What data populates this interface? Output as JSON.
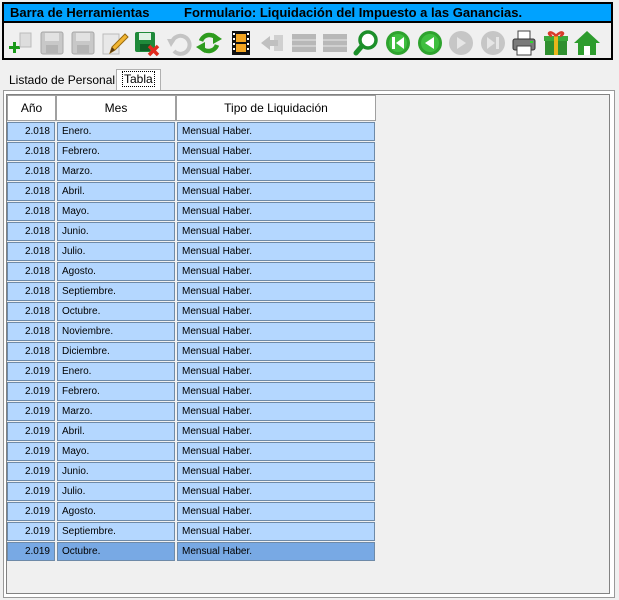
{
  "toolbar": {
    "title_left": "Barra de Herramientas",
    "title_right": "Formulario: Liquidación del Impuesto a las Ganancias.",
    "buttons": [
      {
        "icon": "add-icon",
        "enabled": true
      },
      {
        "icon": "save-icon",
        "enabled": false
      },
      {
        "icon": "save-as-icon",
        "enabled": false
      },
      {
        "icon": "edit-pencil-icon",
        "enabled": true
      },
      {
        "icon": "delete-record-icon",
        "enabled": true
      },
      {
        "icon": "undo-icon",
        "enabled": false
      },
      {
        "icon": "refresh-icon",
        "enabled": true
      },
      {
        "icon": "film-icon",
        "enabled": true
      },
      {
        "icon": "back-arrow-icon",
        "enabled": false
      },
      {
        "icon": "grid-icon",
        "enabled": false
      },
      {
        "icon": "grid-alt-icon",
        "enabled": false
      },
      {
        "icon": "search-icon",
        "enabled": true
      },
      {
        "icon": "first-record-icon",
        "enabled": true
      },
      {
        "icon": "previous-record-icon",
        "enabled": true
      },
      {
        "icon": "next-record-icon",
        "enabled": false
      },
      {
        "icon": "last-record-icon",
        "enabled": false
      },
      {
        "icon": "printer-icon",
        "enabled": true
      },
      {
        "icon": "gift-icon",
        "enabled": true
      },
      {
        "icon": "home-icon",
        "enabled": true
      }
    ]
  },
  "tabs": {
    "listado": "Listado de Personal",
    "tabla": "Tabla"
  },
  "table": {
    "headers": {
      "anio": "Año",
      "mes": "Mes",
      "tipo": "Tipo de Liquidación"
    },
    "rows": [
      {
        "anio": "2.018",
        "mes": "Enero.",
        "tipo": "Mensual Haber."
      },
      {
        "anio": "2.018",
        "mes": "Febrero.",
        "tipo": "Mensual Haber."
      },
      {
        "anio": "2.018",
        "mes": "Marzo.",
        "tipo": "Mensual Haber."
      },
      {
        "anio": "2.018",
        "mes": "Abril.",
        "tipo": "Mensual Haber."
      },
      {
        "anio": "2.018",
        "mes": "Mayo.",
        "tipo": "Mensual Haber."
      },
      {
        "anio": "2.018",
        "mes": "Junio.",
        "tipo": "Mensual Haber."
      },
      {
        "anio": "2.018",
        "mes": "Julio.",
        "tipo": "Mensual Haber."
      },
      {
        "anio": "2.018",
        "mes": "Agosto.",
        "tipo": "Mensual Haber."
      },
      {
        "anio": "2.018",
        "mes": "Septiembre.",
        "tipo": "Mensual Haber."
      },
      {
        "anio": "2.018",
        "mes": "Octubre.",
        "tipo": "Mensual Haber."
      },
      {
        "anio": "2.018",
        "mes": "Noviembre.",
        "tipo": "Mensual Haber."
      },
      {
        "anio": "2.018",
        "mes": "Diciembre.",
        "tipo": "Mensual Haber."
      },
      {
        "anio": "2.019",
        "mes": "Enero.",
        "tipo": "Mensual Haber."
      },
      {
        "anio": "2.019",
        "mes": "Febrero.",
        "tipo": "Mensual Haber."
      },
      {
        "anio": "2.019",
        "mes": "Marzo.",
        "tipo": "Mensual Haber."
      },
      {
        "anio": "2.019",
        "mes": "Abril.",
        "tipo": "Mensual Haber."
      },
      {
        "anio": "2.019",
        "mes": "Mayo.",
        "tipo": "Mensual Haber."
      },
      {
        "anio": "2.019",
        "mes": "Junio.",
        "tipo": "Mensual Haber."
      },
      {
        "anio": "2.019",
        "mes": "Julio.",
        "tipo": "Mensual Haber."
      },
      {
        "anio": "2.019",
        "mes": "Agosto.",
        "tipo": "Mensual Haber."
      },
      {
        "anio": "2.019",
        "mes": "Septiembre.",
        "tipo": "Mensual Haber."
      },
      {
        "anio": "2.019",
        "mes": "Octubre.",
        "tipo": "Mensual Haber.",
        "selected": true
      }
    ]
  },
  "colors": {
    "title_bar": "#00a2ff",
    "row_bg": "#b4d7ff",
    "row_selected": "#78a9e4"
  }
}
